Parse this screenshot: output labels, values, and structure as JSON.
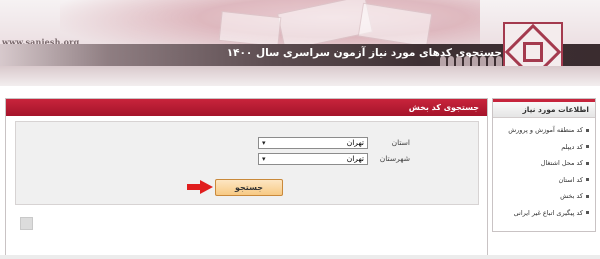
{
  "header": {
    "site_url": "www.sanjesh.org",
    "title": "جستجوی کدهای مورد نیاز آزمون سراسری سال ۱۴۰۰"
  },
  "main": {
    "panel_title": "جستجوی کد بخش",
    "fields": {
      "province": {
        "label": "استان",
        "value": "تهران"
      },
      "city": {
        "label": "شهرستان",
        "value": "تهران"
      }
    },
    "search_label": "جستجو"
  },
  "sidebar": {
    "title": "اطلاعات مورد نیاز",
    "items": [
      {
        "label": "کد منطقه آموزش و پرورش"
      },
      {
        "label": "کد دیپلم"
      },
      {
        "label": "کد محل اشتغال"
      },
      {
        "label": "کد استان"
      },
      {
        "label": "کد بخش"
      },
      {
        "label": "کد پیگیری اتباع غیر ایرانی"
      }
    ]
  },
  "colors": {
    "accent_red": "#c8243c",
    "button_orange": "#f7c984",
    "title_band": "#3e3033"
  }
}
